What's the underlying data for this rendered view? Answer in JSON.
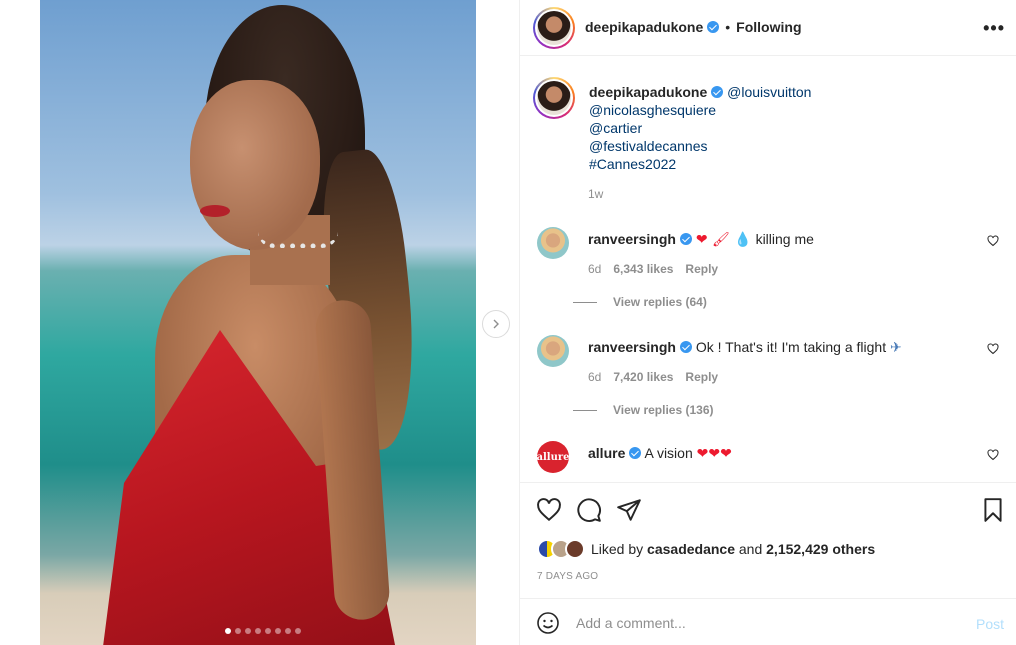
{
  "post": {
    "username": "deepikapadukone",
    "follow_status": "Following",
    "more": "•••",
    "caption_mentions": [
      "@louisvuitton",
      "@nicolasghesquiere",
      "@cartier",
      "@festivaldecannes",
      "#Cannes2022"
    ],
    "caption_time": "1w",
    "image_dots": 8,
    "active_dot": 0
  },
  "comments": [
    {
      "username": "ranveersingh",
      "text": "killing me",
      "emoji_prefix": "❤ 🖌 💧",
      "time": "6d",
      "likes": "6,343 likes",
      "reply": "Reply",
      "view_replies": "View replies (64)"
    },
    {
      "username": "ranveersingh",
      "text": "Ok ! That's it! I'm taking a flight",
      "emoji_suffix": "✈",
      "time": "6d",
      "likes": "7,420 likes",
      "reply": "Reply",
      "view_replies": "View replies (136)"
    },
    {
      "username": "allure",
      "avatar_text": "allure",
      "text": "A vision",
      "emoji_suffix": "❤❤❤"
    }
  ],
  "actions": {
    "liked_by_prefix": "Liked by",
    "liked_by_user": "casadedance",
    "liked_by_and": "and",
    "liked_by_count": "2,152,429 others",
    "date": "7 DAYS AGO"
  },
  "add_comment": {
    "placeholder": "Add a comment...",
    "post_label": "Post"
  },
  "colors": {
    "link": "#00376b",
    "verified": "#3897f0",
    "heart": "#ed1a2f",
    "post_disabled": "#b2dffc"
  }
}
